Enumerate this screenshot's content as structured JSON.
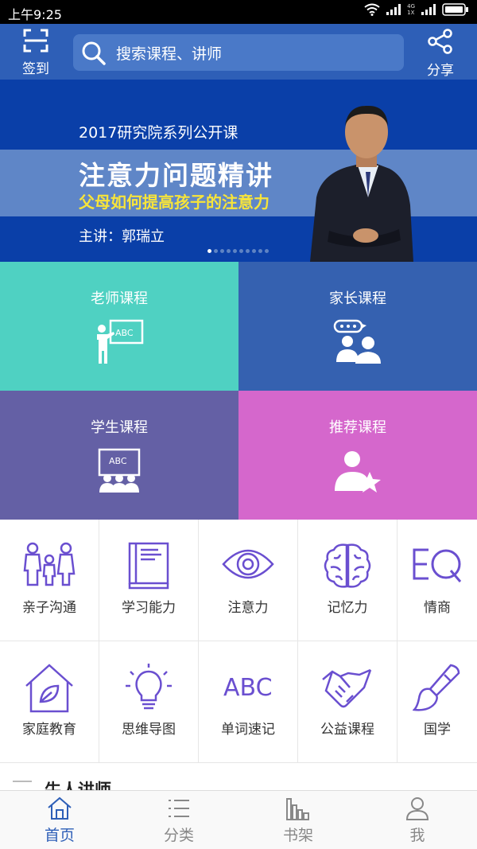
{
  "status_bar": {
    "time": "上午9:25",
    "net_top": "4G",
    "net_bottom": "1X"
  },
  "header": {
    "signin_label": "签到",
    "search_placeholder": "搜索课程、讲师",
    "share_label": "分享"
  },
  "banner": {
    "series": "2017研究院系列公开课",
    "title": "注意力问题精讲",
    "subtitle": "父母如何提高孩子的注意力",
    "speaker": "主讲：郭瑞立",
    "slide_count": 10,
    "active_slide": 1
  },
  "categories": [
    {
      "label": "老师课程",
      "icon": "teacher-board-icon",
      "color": "#4fd1c2"
    },
    {
      "label": "家长课程",
      "icon": "parents-chat-icon",
      "color": "#3561b0"
    },
    {
      "label": "学生课程",
      "icon": "students-board-icon",
      "color": "#6460a5"
    },
    {
      "label": "推荐课程",
      "icon": "person-star-icon",
      "color": "#d567cc"
    }
  ],
  "topics": [
    {
      "label": "亲子沟通",
      "icon": "family-icon"
    },
    {
      "label": "学习能力",
      "icon": "book-icon"
    },
    {
      "label": "注意力",
      "icon": "eye-icon"
    },
    {
      "label": "记忆力",
      "icon": "brain-icon"
    },
    {
      "label": "情商",
      "icon": "eq-icon"
    },
    {
      "label": "家庭教育",
      "icon": "house-leaf-icon"
    },
    {
      "label": "思维导图",
      "icon": "lightbulb-icon"
    },
    {
      "label": "单词速记",
      "icon": "abc-icon"
    },
    {
      "label": "公益课程",
      "icon": "handshake-icon"
    },
    {
      "label": "国学",
      "icon": "brush-icon"
    }
  ],
  "section": {
    "title": "牛人讲师"
  },
  "bottom_nav": [
    {
      "label": "首页",
      "icon": "home-icon",
      "active": true
    },
    {
      "label": "分类",
      "icon": "list-icon",
      "active": false
    },
    {
      "label": "书架",
      "icon": "bookshelf-icon",
      "active": false
    },
    {
      "label": "我",
      "icon": "user-icon",
      "active": false
    }
  ],
  "colors": {
    "primary": "#2e5fb7",
    "icon_purple": "#6a4fd0",
    "banner_bg": "#0a3fa8",
    "banner_subtitle": "#f7e43a"
  }
}
